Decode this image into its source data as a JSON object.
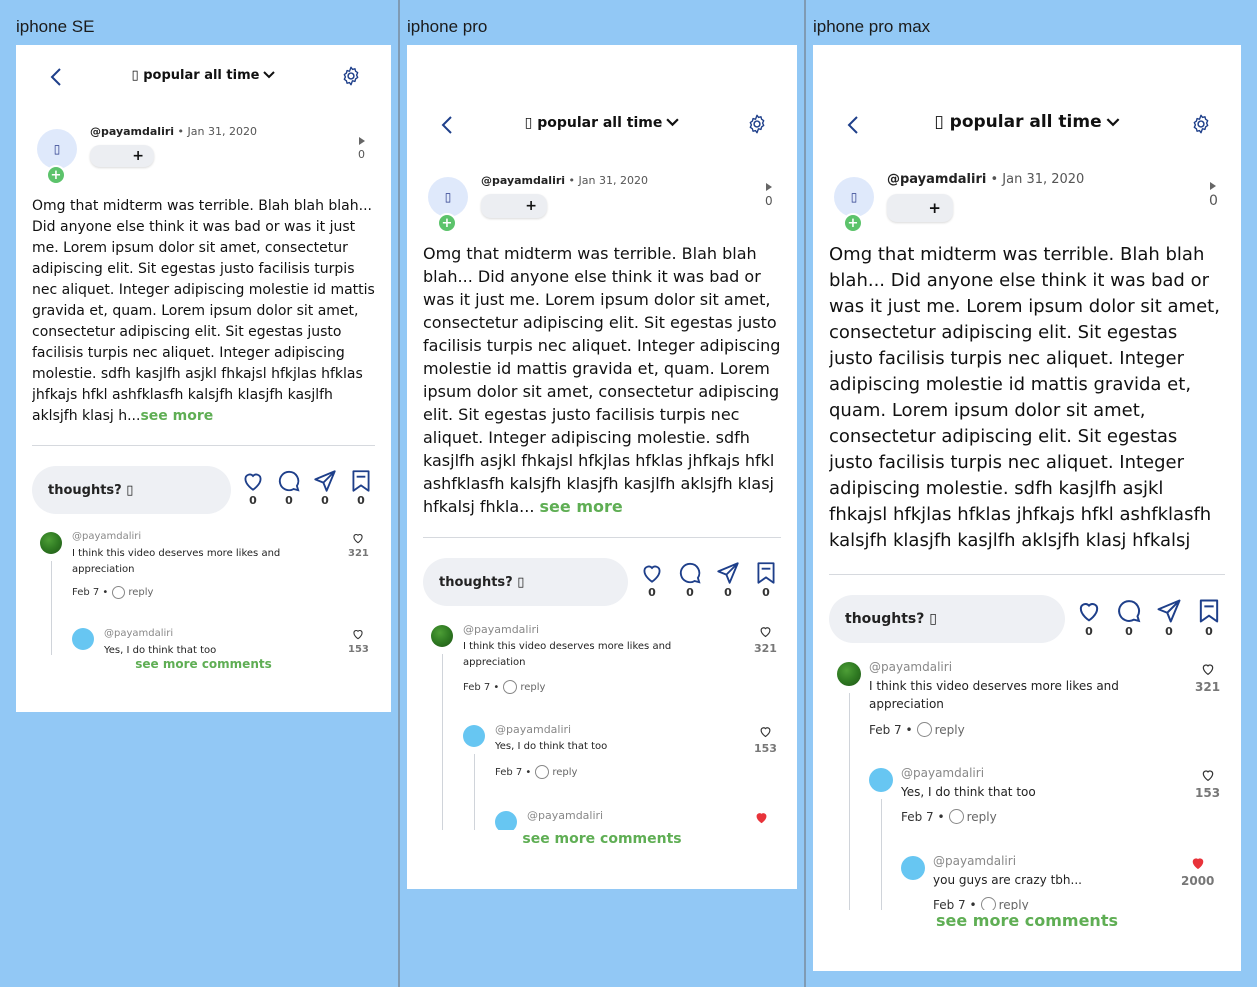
{
  "devices": [
    {
      "label": "iphone SE"
    },
    {
      "label": "iphone pro"
    },
    {
      "label": "iphone pro max"
    }
  ],
  "header": {
    "sort_label": "▯ popular all time"
  },
  "post": {
    "handle": "@payamdaliri",
    "date": "• Jan 31, 2020",
    "avatar_glyph": "▯",
    "follow_plus": "+",
    "views": "0",
    "body_short": "Omg that midterm was terrible. Blah blah blah... Did anyone else think it was bad or was it just me. Lorem ipsum dolor sit amet, consectetur adipiscing elit. Sit egestas justo facilisis turpis nec aliquet. Integer adipiscing molestie id mattis gravida et, quam. Lorem ipsum dolor sit amet, consectetur adipiscing elit. Sit egestas justo facilisis turpis nec aliquet. Integer adipiscing molestie. sdfh kasjlfh asjkl fhkajsl hfkjlas hfklas jhfkajs hfkl ashfklasfh kalsjfh klasjfh kasjlfh aklsjfh klasj h...",
    "body_long": "Omg that midterm was terrible. Blah blah blah... Did anyone else think it was bad or was it just me. Lorem ipsum dolor sit amet, consectetur adipiscing elit. Sit egestas justo facilisis turpis nec aliquet. Integer adipiscing molestie id mattis gravida et, quam. Lorem ipsum dolor sit amet, consectetur adipiscing elit. Sit egestas justo facilisis turpis nec aliquet. Integer adipiscing molestie. sdfh kasjlfh asjkl fhkajsl hfkjlas hfklas jhfkajs hfkl ashfklasfh kalsjfh klasjfh kasjlfh aklsjfh klasj hfkalsj fhkla...",
    "see_more": "see more"
  },
  "actions": {
    "thoughts_placeholder": "thoughts? ▯",
    "like_count": "0",
    "comment_count": "0",
    "share_count": "0",
    "save_count": "0"
  },
  "comments": [
    {
      "handle": "@payamdaliri",
      "text": "I think this video deserves more likes and appreciation",
      "date": "Feb 7 •",
      "reply": "reply",
      "likes": "321"
    },
    {
      "handle": "@payamdaliri",
      "text": "Yes, I do think that too",
      "date": "Feb 7 •",
      "reply": "reply",
      "likes": "153"
    },
    {
      "handle": "@payamdaliri",
      "text": "you guys are crazy tbh...",
      "date": "Feb 7 •",
      "reply": "reply",
      "likes": "2000"
    }
  ],
  "see_more_comments": "see more comments",
  "colors": {
    "accent_green": "#5fae54",
    "background": "#92c8f5",
    "heart_red": "#e8333a"
  },
  "icons": [
    "back-arrow-icon",
    "chevron-down-icon",
    "gear-icon",
    "play-icon",
    "heart-icon",
    "comment-bubble-icon",
    "send-icon",
    "bookmark-icon"
  ]
}
